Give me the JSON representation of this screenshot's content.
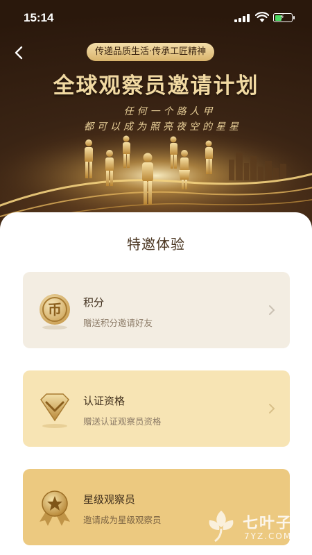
{
  "status_bar": {
    "time": "15:14"
  },
  "hero": {
    "tagline": "传递品质生活·传承工匠精神",
    "title": "全球观察员邀请计划",
    "subtitle_line1": "任何一个路人甲",
    "subtitle_line2": "都可以成为照亮夜空的星星"
  },
  "section": {
    "title": "特邀体验"
  },
  "cards": [
    {
      "title": "积分",
      "description": "赠送积分邀请好友",
      "icon": "coin-icon"
    },
    {
      "title": "认证资格",
      "description": "赠送认证观察员资格",
      "icon": "diamond-badge-icon"
    },
    {
      "title": "星级观察员",
      "description": "邀请成为星级观察员",
      "icon": "star-medal-icon"
    }
  ],
  "watermark": {
    "name": "七叶子",
    "url": "7YZ.COM"
  },
  "colors": {
    "hero_bg": "#2a180c",
    "gold": "#f1d9a2",
    "card1": "#f3ede2",
    "card2": "#f7e4b4",
    "card3": "#ecc980"
  }
}
